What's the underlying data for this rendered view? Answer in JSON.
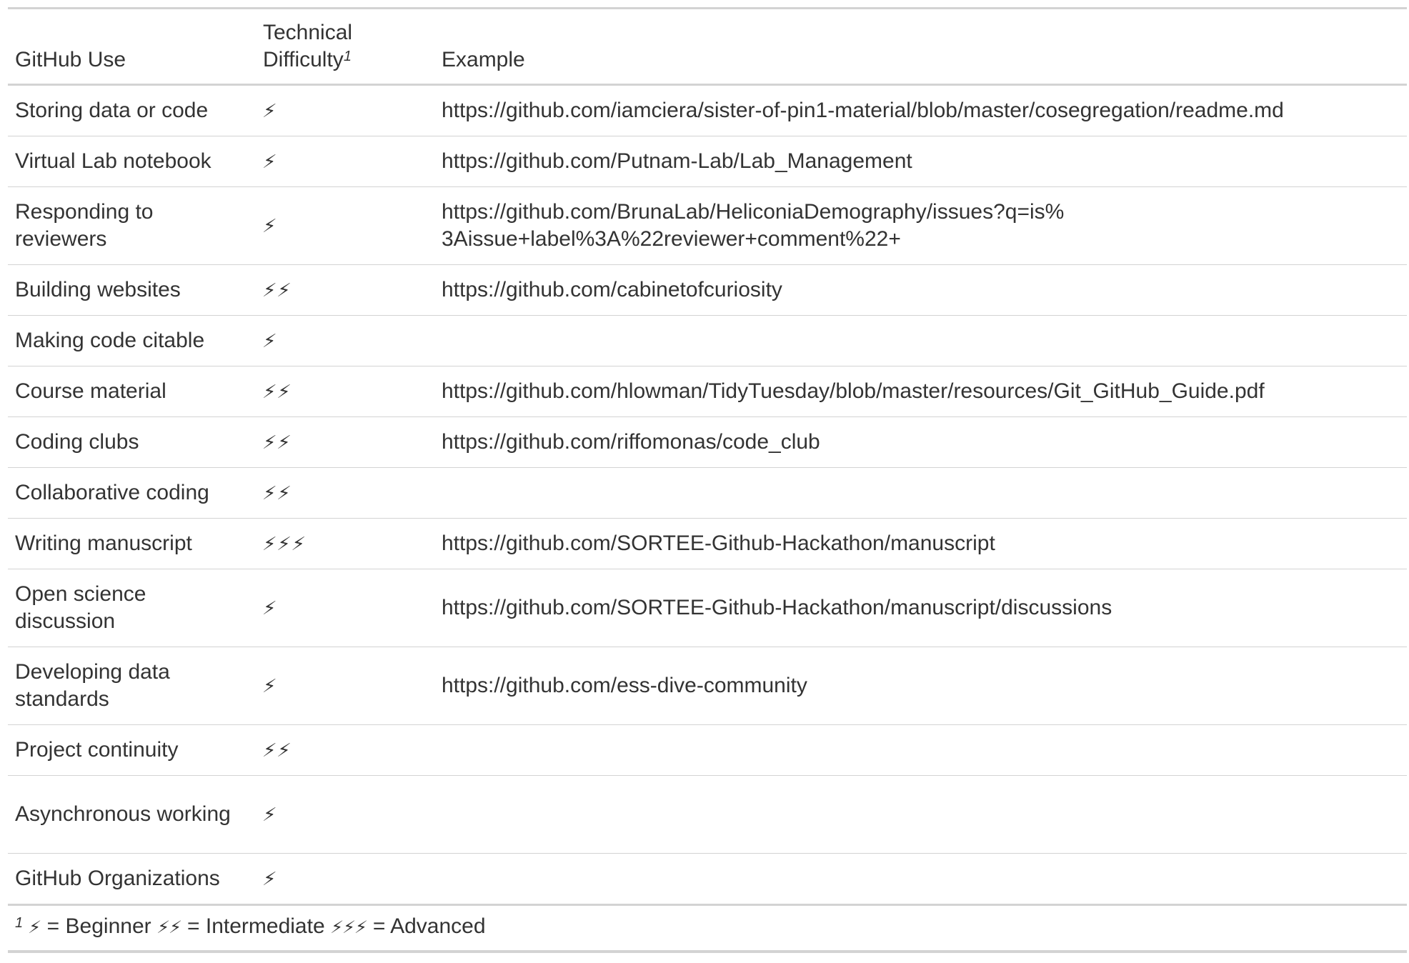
{
  "table": {
    "headers": {
      "use": "GitHub Use",
      "difficulty_line1": "Technical",
      "difficulty_line2": "Difficulty",
      "difficulty_marker": "1",
      "example": "Example"
    },
    "rows": [
      {
        "use": "Storing data or code",
        "difficulty": "⚡",
        "level": 1,
        "example": "https://github.com/iamciera/sister-of-pin1-material/blob/master/cosegregation/readme.md"
      },
      {
        "use": "Virtual Lab notebook",
        "difficulty": "⚡",
        "level": 1,
        "example": "https://github.com/Putnam-Lab/Lab_Management"
      },
      {
        "use": "Responding to reviewers",
        "difficulty": "⚡",
        "level": 1,
        "example": "https://github.com/BrunaLab/HeliconiaDemography/issues?q=is%3Aissue+label%3A%22reviewer+comment%22+"
      },
      {
        "use": "Building websites",
        "difficulty": "⚡⚡",
        "level": 2,
        "example": "https://github.com/cabinetofcuriosity"
      },
      {
        "use": "Making code citable",
        "difficulty": "⚡",
        "level": 1,
        "example": ""
      },
      {
        "use": "Course material",
        "difficulty": "⚡⚡",
        "level": 2,
        "example": "https://github.com/hlowman/TidyTuesday/blob/master/resources/Git_GitHub_Guide.pdf"
      },
      {
        "use": "Coding clubs",
        "difficulty": "⚡⚡",
        "level": 2,
        "example": "https://github.com/riffomonas/code_club"
      },
      {
        "use": "Collaborative coding",
        "difficulty": "⚡⚡",
        "level": 2,
        "example": ""
      },
      {
        "use": "Writing manuscript",
        "difficulty": "⚡⚡⚡",
        "level": 3,
        "example": "https://github.com/SORTEE-Github-Hackathon/manuscript"
      },
      {
        "use": "Open science discussion",
        "difficulty": "⚡",
        "level": 1,
        "example": "https://github.com/SORTEE-Github-Hackathon/manuscript/discussions"
      },
      {
        "use": "Developing data standards",
        "difficulty": "⚡",
        "level": 1,
        "example": "https://github.com/ess-dive-community"
      },
      {
        "use": "Project continuity",
        "difficulty": "⚡⚡",
        "level": 2,
        "example": ""
      },
      {
        "use": "Asynchronous working",
        "difficulty": "⚡",
        "level": 1,
        "example": ""
      },
      {
        "use": "GitHub Organizations",
        "difficulty": "⚡",
        "level": 1,
        "example": ""
      }
    ],
    "footnote": {
      "marker": "1",
      "beginner_icon": "⚡",
      "beginner_text": "= Beginner",
      "intermediate_icon": "⚡⚡",
      "intermediate_text": "= Intermediate",
      "advanced_icon": "⚡⚡⚡",
      "advanced_text": "= Advanced"
    }
  }
}
